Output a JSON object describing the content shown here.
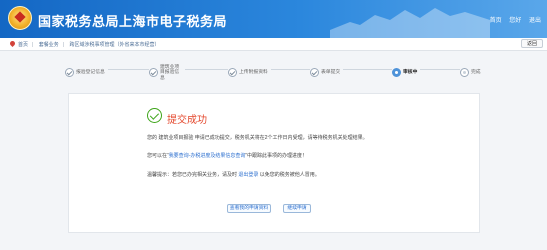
{
  "header": {
    "title": "国家税务总局上海市电子税务局",
    "links": [
      "首页",
      "您好",
      "退出"
    ]
  },
  "breadcrumb": {
    "items": [
      "首页",
      "套餐业务",
      "跨区域涉税事项管理（外省来本市经营）"
    ],
    "back_label": "返回"
  },
  "steps": [
    {
      "label": "报验登记信息",
      "state": "done"
    },
    {
      "label": "建筑业项目报验信息",
      "state": "done"
    },
    {
      "label": "上传附报资料",
      "state": "done"
    },
    {
      "label": "表单提交",
      "state": "done"
    },
    {
      "label": "审核中",
      "state": "active"
    },
    {
      "label": "完成",
      "state": "pending"
    }
  ],
  "result": {
    "title": "提交成功",
    "line1": "您的 建筑业项目报验 申请已成功提交，税务机关将在2个工作日内受理，请等待税务机关处理结果。",
    "line2_prefix": "您可以在“",
    "line2_link": "我要查询-办税进度及结果信息查询",
    "line2_suffix": "”中跟踪此事项的办理进度！",
    "line3_prefix": "温馨提示：若您已办完相关业务，请及时 ",
    "line3_link": "退出登录",
    "line3_suffix": " 以免您的税务被他人冒用。"
  },
  "buttons": {
    "view": "查看我的申请资料",
    "continue": "继续申请"
  }
}
